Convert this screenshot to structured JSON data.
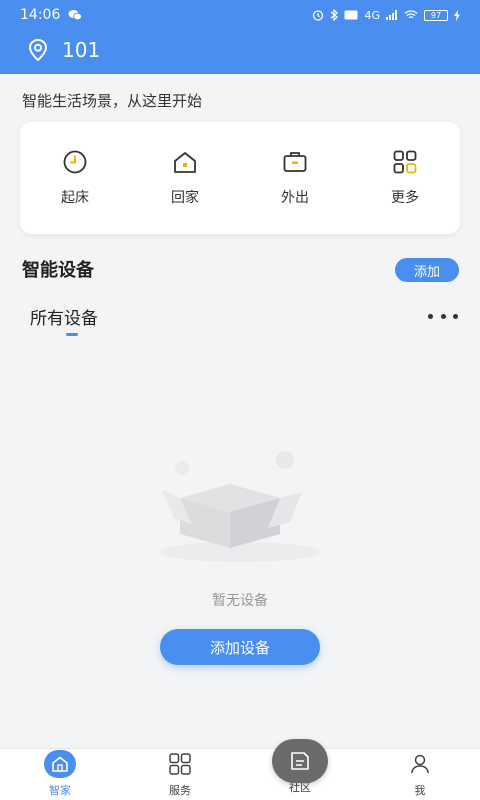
{
  "status_bar": {
    "time": "14:06",
    "network": "4G",
    "battery": "97"
  },
  "header": {
    "title": "101",
    "icon": "location-pin-icon"
  },
  "tagline": "智能生活场景，从这里开始",
  "scenes": [
    {
      "label": "起床",
      "icon": "clock-icon"
    },
    {
      "label": "回家",
      "icon": "home-icon"
    },
    {
      "label": "外出",
      "icon": "briefcase-icon"
    },
    {
      "label": "更多",
      "icon": "grid-icon"
    }
  ],
  "devices": {
    "section_title": "智能设备",
    "add_label": "添加",
    "tab_all": "所有设备",
    "empty_text": "暂无设备",
    "add_device_label": "添加设备"
  },
  "bottom_nav": [
    {
      "label": "智家",
      "icon": "home-icon",
      "active": true
    },
    {
      "label": "服务",
      "icon": "grid-icon",
      "active": false
    },
    {
      "label": "社区",
      "icon": "community-icon",
      "active": false
    },
    {
      "label": "我",
      "icon": "person-icon",
      "active": false
    }
  ],
  "colors": {
    "accent": "#4a8ef0",
    "scene_icon_accent": "#f0b400"
  }
}
